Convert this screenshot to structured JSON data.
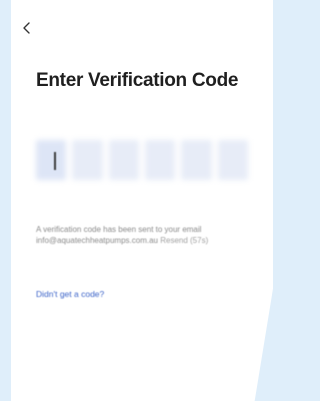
{
  "screen": {
    "title": "Enter Verification Code",
    "message_prefix": "A verification code has been sent to your email",
    "email": "info@aquatechheatpumps.com.au",
    "resend_label": "Resend (57s)",
    "didnt_get_code_label": "Didn't get a code?"
  },
  "code_input": {
    "box_count": 6,
    "value": ""
  },
  "colors": {
    "page_background": "#dfeefa",
    "card_background": "#ffffff",
    "title": "#1f1f1f",
    "code_box": "#e7ecf7",
    "message_text": "#8a8a8a",
    "link": "#3b63c8"
  },
  "icons": {
    "back": "chevron-left-icon"
  }
}
